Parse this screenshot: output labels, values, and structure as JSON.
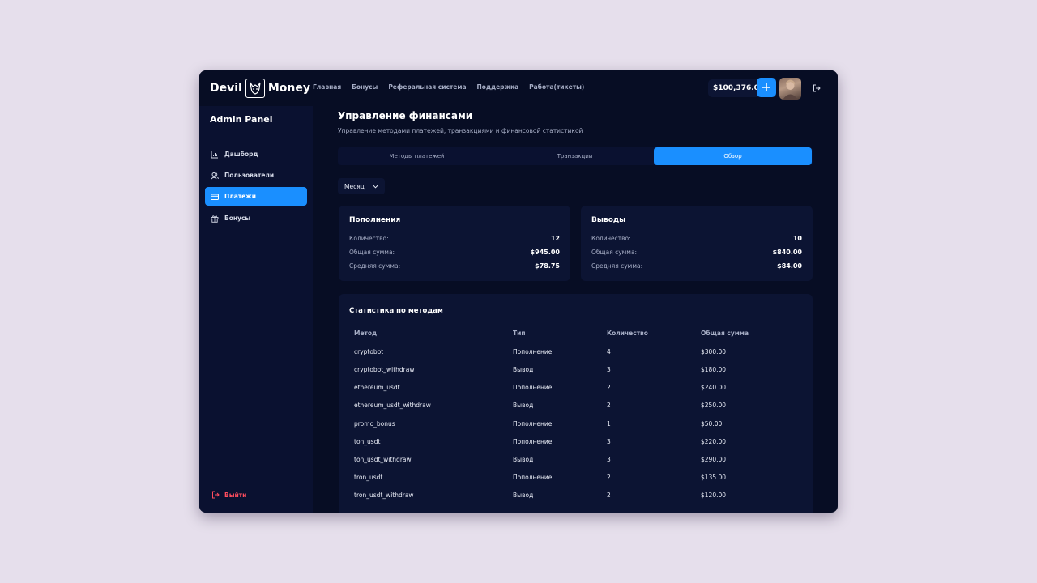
{
  "header": {
    "logo_left": "Devil",
    "logo_right": "Money",
    "nav": [
      "Главная",
      "Бонусы",
      "Реферальная система",
      "Поддержка",
      "Работа(тикеты)"
    ],
    "balance": "$100,376.04",
    "add_icon": "plus-icon",
    "logout_icon": "logout-icon"
  },
  "sidebar": {
    "title": "Admin Panel",
    "items": [
      {
        "label": "Дашборд",
        "icon": "chart-icon",
        "active": false
      },
      {
        "label": "Пользователи",
        "icon": "users-icon",
        "active": false
      },
      {
        "label": "Платежи",
        "icon": "card-icon",
        "active": true
      },
      {
        "label": "Бонусы",
        "icon": "gift-icon",
        "active": false
      }
    ],
    "exit_label": "Выйти"
  },
  "main": {
    "title": "Управление финансами",
    "subtitle": "Управление методами платежей, транзакциями и финансовой статистикой",
    "tabs": [
      {
        "label": "Методы платежей",
        "active": false
      },
      {
        "label": "Транзакции",
        "active": false
      },
      {
        "label": "Обзор",
        "active": true
      }
    ],
    "period": "Месяц",
    "deposits": {
      "title": "Пополнения",
      "rows": [
        {
          "label": "Количество:",
          "value": "12"
        },
        {
          "label": "Общая сумма:",
          "value": "$945.00"
        },
        {
          "label": "Средняя сумма:",
          "value": "$78.75"
        }
      ]
    },
    "withdrawals": {
      "title": "Выводы",
      "rows": [
        {
          "label": "Количество:",
          "value": "10"
        },
        {
          "label": "Общая сумма:",
          "value": "$840.00"
        },
        {
          "label": "Средняя сумма:",
          "value": "$84.00"
        }
      ]
    },
    "methods": {
      "title": "Статистика по методам",
      "columns": [
        "Метод",
        "Тип",
        "Количество",
        "Общая сумма"
      ],
      "rows": [
        [
          "cryptobot",
          "Пополнение",
          "4",
          "$300.00"
        ],
        [
          "cryptobot_withdraw",
          "Вывод",
          "3",
          "$180.00"
        ],
        [
          "ethereum_usdt",
          "Пополнение",
          "2",
          "$240.00"
        ],
        [
          "ethereum_usdt_withdraw",
          "Вывод",
          "2",
          "$250.00"
        ],
        [
          "promo_bonus",
          "Пополнение",
          "1",
          "$50.00"
        ],
        [
          "ton_usdt",
          "Пополнение",
          "3",
          "$220.00"
        ],
        [
          "ton_usdt_withdraw",
          "Вывод",
          "3",
          "$290.00"
        ],
        [
          "tron_usdt",
          "Пополнение",
          "2",
          "$135.00"
        ],
        [
          "tron_usdt_withdraw",
          "Вывод",
          "2",
          "$120.00"
        ]
      ]
    }
  },
  "colors": {
    "accent": "#1a8fff",
    "background": "#070d24",
    "panel": "#0c1433",
    "danger": "#ff4d5e"
  }
}
